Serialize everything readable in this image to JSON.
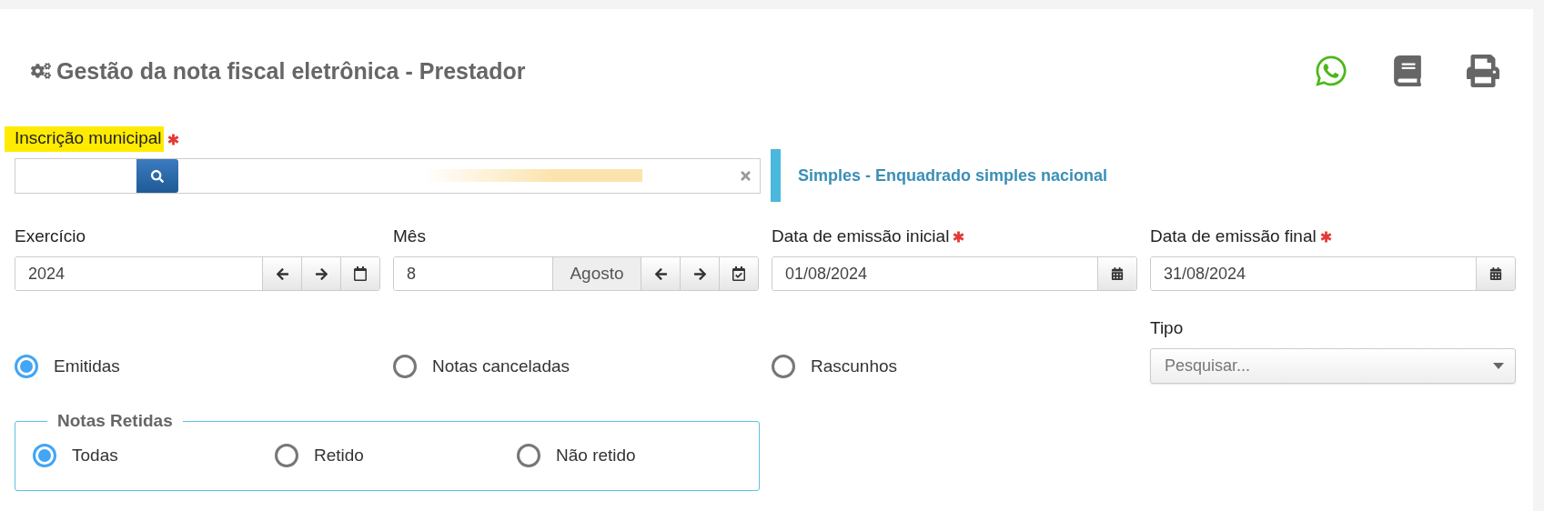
{
  "header": {
    "title": "Gestão da nota fiscal eletrônica - Prestador"
  },
  "inscricao": {
    "label": "Inscrição municipal",
    "required": true,
    "highlighted": true
  },
  "regime": {
    "text": "Simples - Enquadrado simples nacional"
  },
  "fields": [
    {
      "kind": "year",
      "label": "Exercício",
      "value": "2024"
    },
    {
      "kind": "month",
      "label": "Mês",
      "value": "8",
      "month_name": "Agosto"
    },
    {
      "kind": "date",
      "label": "Data de emissão inicial",
      "required": true,
      "value": "01/08/2024"
    },
    {
      "kind": "date",
      "label": "Data de emissão final",
      "required": true,
      "value": "31/08/2024"
    }
  ],
  "status_options": [
    {
      "label": "Emitidas",
      "selected": true
    },
    {
      "label": "Notas canceladas",
      "selected": false
    },
    {
      "label": "Rascunhos",
      "selected": false
    }
  ],
  "tipo": {
    "label": "Tipo",
    "placeholder": "Pesquisar..."
  },
  "notas_retidas": {
    "legend": "Notas Retidas",
    "options": [
      {
        "label": "Todas",
        "selected": true
      },
      {
        "label": "Retido",
        "selected": false
      },
      {
        "label": "Não retido",
        "selected": false
      }
    ]
  }
}
